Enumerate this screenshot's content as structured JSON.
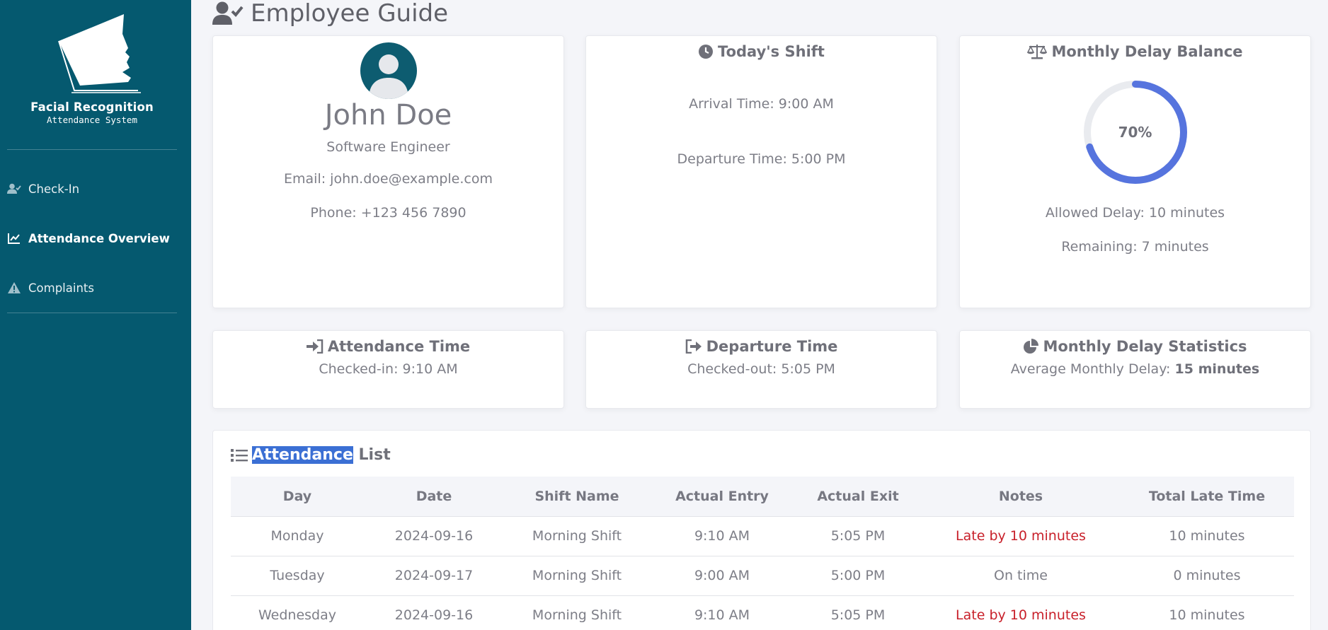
{
  "app": {
    "logo_title": "Facial Recognition",
    "logo_subtitle": "Attendance System"
  },
  "sidebar": {
    "items": [
      {
        "label": "Check-In",
        "icon": "user-check-icon",
        "active": false
      },
      {
        "label": "Attendance Overview",
        "icon": "chart-line-icon",
        "active": true
      },
      {
        "label": "Complaints",
        "icon": "warning-icon",
        "active": false
      }
    ]
  },
  "header": {
    "title": "Employee Guide",
    "icon": "user-check-icon"
  },
  "profile": {
    "name": "John Doe",
    "role": "Software Engineer",
    "email": "Email: john.doe@example.com",
    "phone": "Phone: +123 456 7890",
    "avatar_icon": "user-avatar-icon"
  },
  "shift": {
    "title": "Today's Shift",
    "icon": "clock-icon",
    "arrival": "Arrival Time: 9:00 AM",
    "departure": "Departure Time: 5:00 PM"
  },
  "delay_balance": {
    "title": "Monthly Delay Balance",
    "icon": "scale-icon",
    "percent_label": "70%",
    "percent_value": 70,
    "allowed": "Allowed Delay: 10 minutes",
    "remaining": "Remaining: 7 minutes",
    "gauge_color": "#5674de",
    "track_color": "#e9ebef"
  },
  "attendance_time": {
    "title": "Attendance Time",
    "icon": "sign-in-icon",
    "value": "Checked-in: 9:10 AM"
  },
  "departure_time": {
    "title": "Departure Time",
    "icon": "sign-out-icon",
    "value": "Checked-out: 5:05 PM"
  },
  "delay_stats": {
    "title": "Monthly Delay Statistics",
    "icon": "pie-chart-icon",
    "prefix": "Average Monthly Delay: ",
    "value": "15 minutes"
  },
  "attendance_list": {
    "title_highlight": "Attendance",
    "title_rest": " List",
    "icon": "list-icon",
    "columns": [
      "Day",
      "Date",
      "Shift Name",
      "Actual Entry",
      "Actual Exit",
      "Notes",
      "Total Late Time"
    ],
    "rows": [
      [
        "Monday",
        "2024-09-16",
        "Morning Shift",
        "9:10 AM",
        "5:05 PM",
        "Late by 10 minutes",
        "10 minutes"
      ],
      [
        "Tuesday",
        "2024-09-17",
        "Morning Shift",
        "9:00 AM",
        "5:00 PM",
        "On time",
        "0 minutes"
      ],
      [
        "Wednesday",
        "2024-09-16",
        "Morning Shift",
        "9:10 AM",
        "5:05 PM",
        "Late by 10 minutes",
        "10 minutes"
      ]
    ],
    "late_color": "#c8202a"
  },
  "colors": {
    "sidebar": "#05596f",
    "highlight": "#3b6fd4"
  }
}
